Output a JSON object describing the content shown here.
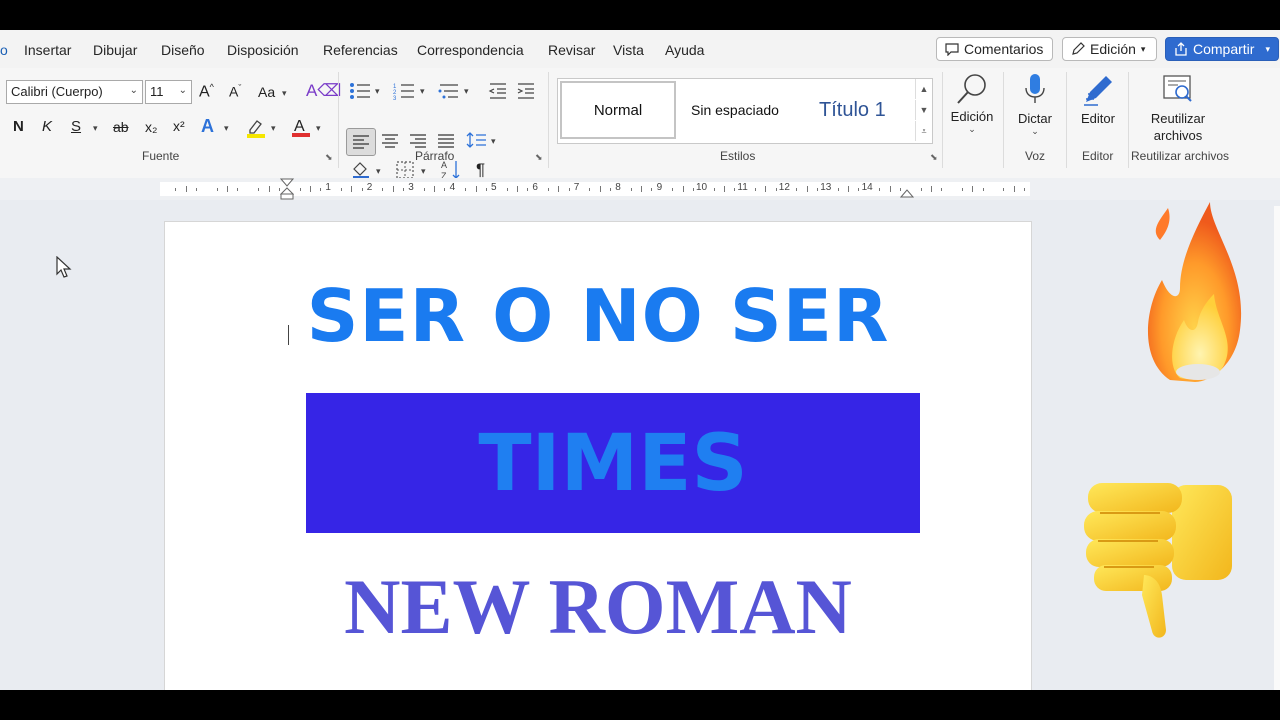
{
  "menu": {
    "partial_first": "o",
    "tabs": [
      "Insertar",
      "Dibujar",
      "Diseño",
      "Disposición",
      "Referencias",
      "Correspondencia",
      "Revisar",
      "Vista",
      "Ayuda"
    ],
    "comments_label": "Comentarios",
    "edit_mode_label": "Edición",
    "share_label": "Compartir"
  },
  "ribbon": {
    "font_name": "Calibri (Cuerpo)",
    "font_size": "11",
    "change_case": "Aa",
    "bold": "N",
    "italic": "K",
    "underline": "S",
    "strike": "ab",
    "subscript": "x₂",
    "superscript": "x²",
    "pilcrow": "¶",
    "groups": {
      "fuente": "Fuente",
      "parrafo": "Párrafo",
      "estilos": "Estilos",
      "voz": "Voz",
      "editor": "Editor",
      "reutilizar": "Reutilizar archivos"
    },
    "styles": {
      "normal": "Normal",
      "no_spacing": "Sin espaciado",
      "title1": "Título 1"
    },
    "edicion_label": "Edición",
    "dictar_label": "Dictar",
    "editor_label": "Editor",
    "reutilizar_line1": "Reutilizar",
    "reutilizar_line2": "archivos"
  },
  "ruler_numbers": [
    "1",
    "2",
    "3",
    "4",
    "5",
    "6",
    "7",
    "8",
    "9",
    "10",
    "11",
    "12",
    "13",
    "14"
  ],
  "document": {
    "heading": "SER O NO SER",
    "box_text": "TIMES",
    "last_line": "NEW ROMAN"
  },
  "colors": {
    "heading": "#1a7bf0",
    "box_bg": "#3625e6",
    "box_text": "#1f7ff1",
    "serif_text": "#5655d6",
    "share_btn": "#2f6bcf"
  },
  "icons": [
    "fire-emoji",
    "thumbs-down-emoji",
    "mouse-pointer-icon",
    "microphone-icon",
    "search-icon",
    "editor-pen-icon",
    "reuse-files-icon"
  ]
}
